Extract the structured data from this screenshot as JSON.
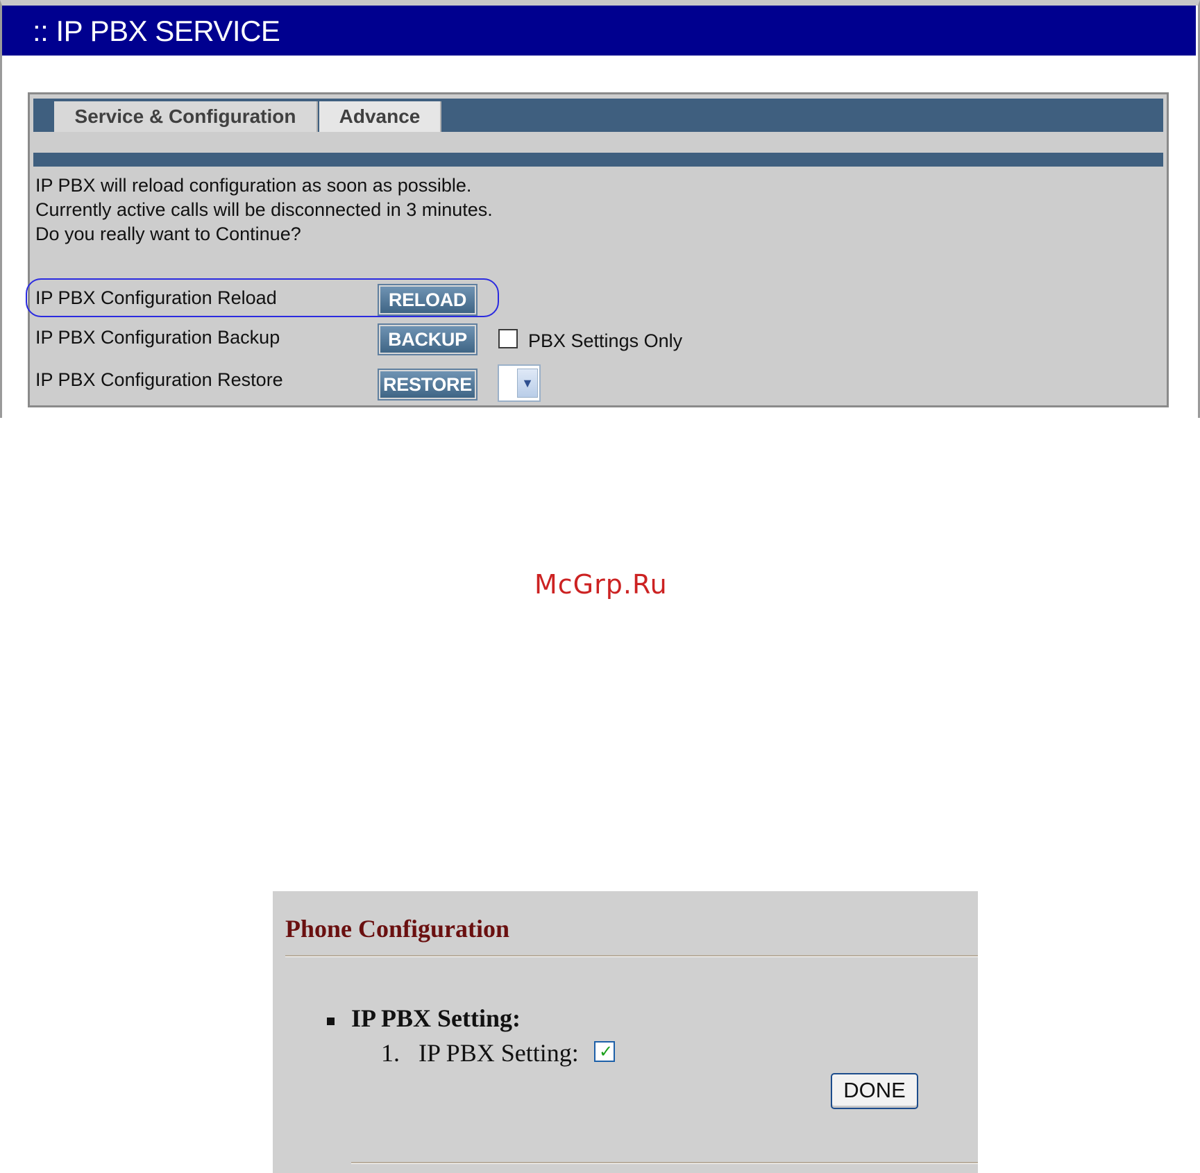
{
  "service_panel": {
    "title": ":: IP PBX SERVICE",
    "tabs": [
      {
        "label": "Service & Configuration",
        "active": true
      },
      {
        "label": "Advance",
        "active": false
      }
    ],
    "messages": [
      "IP PBX will reload configuration as soon as possible.",
      "Currently active calls will be disconnected in 3 minutes.",
      "Do you really want to Continue?"
    ],
    "rows": {
      "reload": {
        "label": "IP PBX Configuration Reload",
        "button": "RELOAD"
      },
      "backup": {
        "label": "IP PBX Configuration Backup",
        "button": "BACKUP",
        "checkbox_label": "PBX Settings Only",
        "checkbox_checked": false
      },
      "restore": {
        "label": "IP PBX Configuration Restore",
        "button": "RESTORE",
        "select_value": ""
      }
    },
    "colors": {
      "title_bar": "#00008f",
      "tab_bar": "#3f5f7f",
      "button": "#4f7595",
      "highlight": "#2a2ae0"
    }
  },
  "watermark": {
    "text": "McGrp.Ru",
    "color": "#cc2222"
  },
  "phone_config": {
    "title": "Phone Configuration",
    "section": "IP PBX Setting:",
    "item_number": "1.",
    "item_label": "IP PBX Setting:",
    "item_checked": true,
    "done_label": "DONE",
    "colors": {
      "title": "#6a1010",
      "check": "#1aa01a"
    }
  }
}
